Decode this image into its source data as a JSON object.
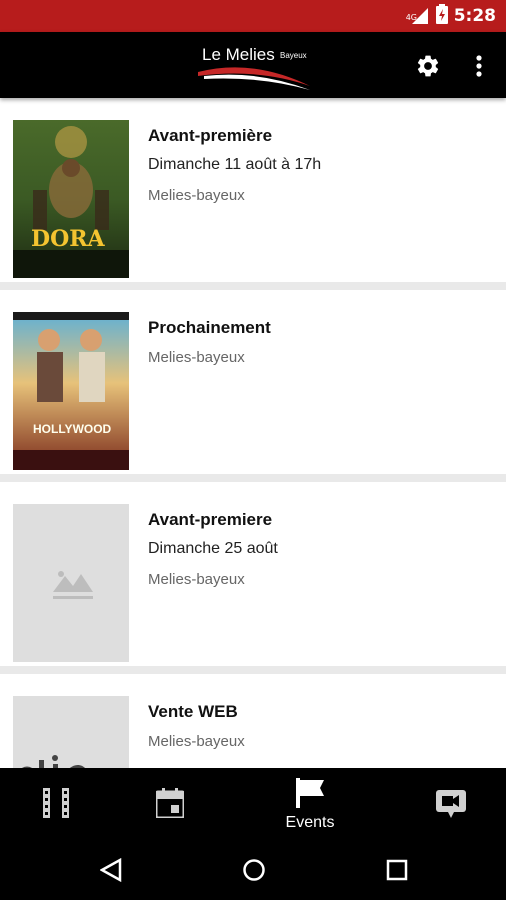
{
  "status_bar": {
    "time": "5:28",
    "network": "4G",
    "color": "#b71c1c"
  },
  "app_bar": {
    "logo_main": "Le Melies",
    "logo_sub": "Bayeux",
    "icons": [
      "gear-icon",
      "more-vert-icon"
    ]
  },
  "events": [
    {
      "title": "Avant-première",
      "date": "Dimanche 11 août à 17h",
      "venue": "Melies-bayeux",
      "poster_title": "DORA"
    },
    {
      "title": "Prochainement",
      "date": "",
      "venue": "Melies-bayeux",
      "poster_title": "HOLLYWOOD"
    },
    {
      "title": "Avant-premiere",
      "date": "Dimanche 25 août",
      "venue": "Melies-bayeux",
      "poster_title": ""
    },
    {
      "title": "Vente WEB",
      "date": "",
      "venue": "Melies-bayeux",
      "poster_title": ""
    }
  ],
  "bottom_nav": {
    "items": [
      {
        "icon": "film-icon",
        "label": ""
      },
      {
        "icon": "calendar-icon",
        "label": ""
      },
      {
        "icon": "flag-icon",
        "label": "Events",
        "active": true
      },
      {
        "icon": "video-icon",
        "label": ""
      }
    ]
  },
  "system_nav": {
    "icons": [
      "back-icon",
      "home-icon",
      "recents-icon"
    ]
  },
  "colors": {
    "accent": "#b71c1c",
    "toolbar": "#000000",
    "placeholder": "#dedede"
  }
}
